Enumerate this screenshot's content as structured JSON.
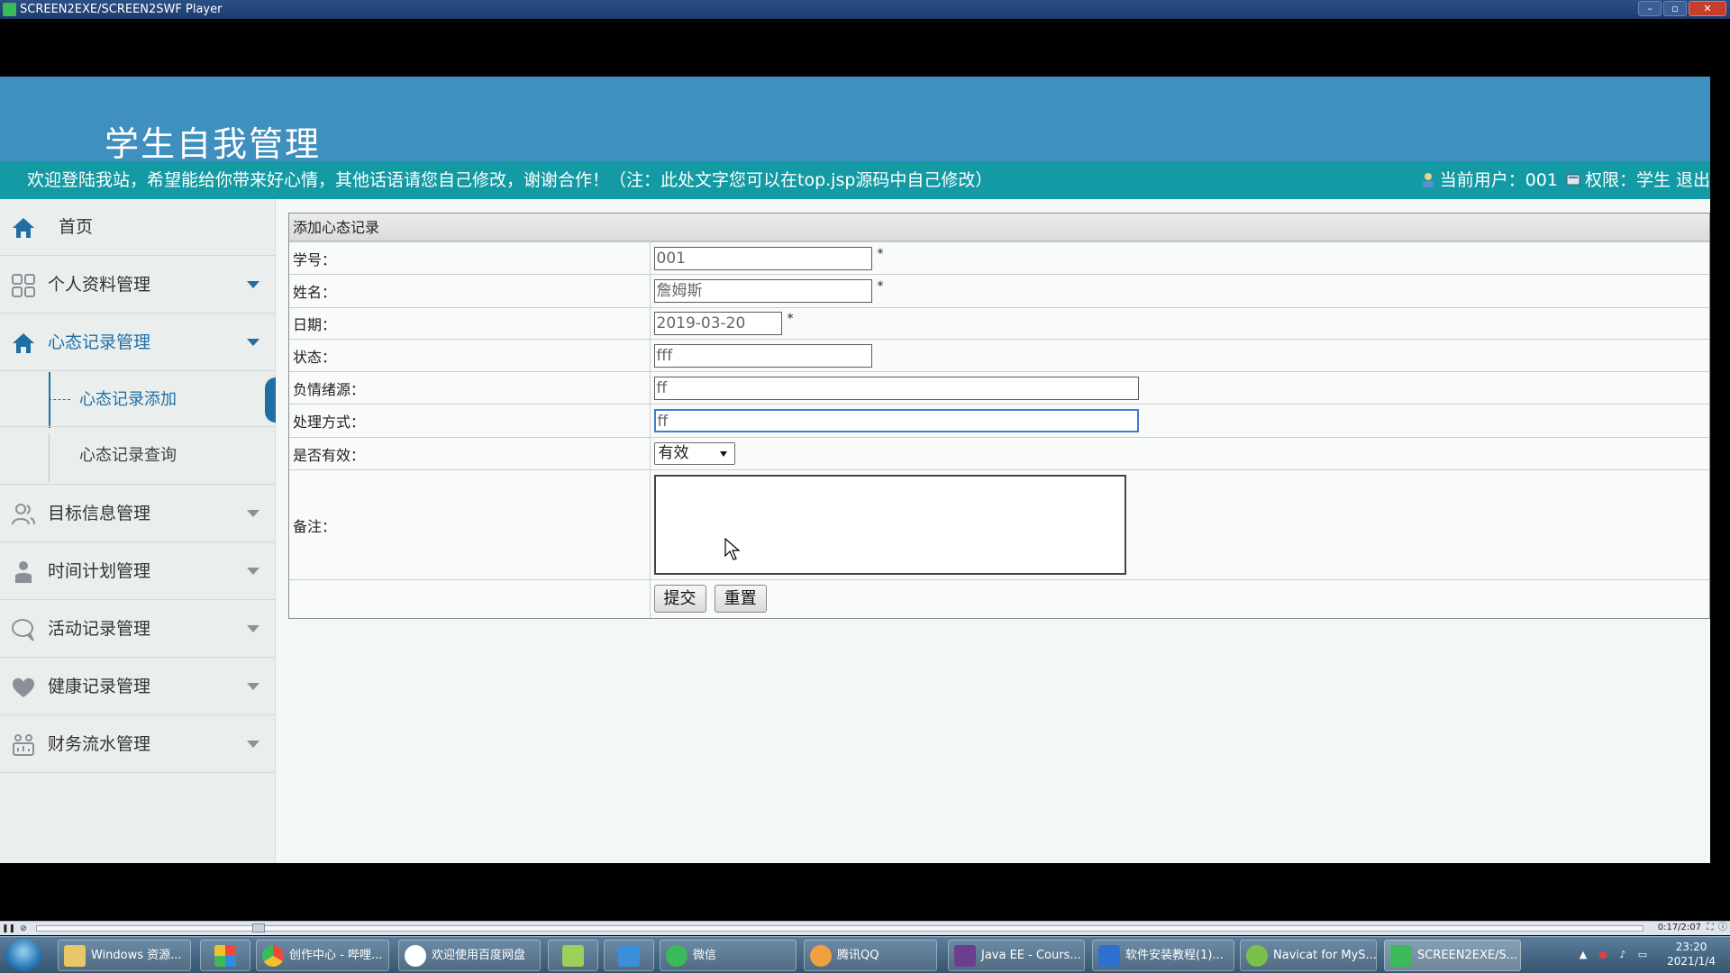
{
  "player": {
    "title": "SCREEN2EXE/SCREEN2SWF Player",
    "time": "0:17/2:07"
  },
  "site": {
    "title": "学生自我管理",
    "welcome": "欢迎登陆我站，希望能给你带来好心情，其他话语请您自己修改，谢谢合作！（注：此处文字您可以在top.jsp源码中自己修改）",
    "current_user_label": "当前用户：001",
    "role_label": "权限：学生",
    "logout": "退出"
  },
  "sidebar": {
    "home": "首页",
    "items": [
      {
        "label": "个人资料管理",
        "icon": "grid-icon"
      },
      {
        "label": "心态记录管理",
        "icon": "home-icon"
      },
      {
        "label": "目标信息管理",
        "icon": "users-icon"
      },
      {
        "label": "时间计划管理",
        "icon": "person-icon"
      },
      {
        "label": "活动记录管理",
        "icon": "chat-icon"
      },
      {
        "label": "健康记录管理",
        "icon": "heart-icon"
      },
      {
        "label": "财务流水管理",
        "icon": "chart-icon"
      }
    ],
    "sub_items": [
      "心态记录添加",
      "心态记录查询"
    ]
  },
  "form": {
    "title": "添加心态记录",
    "student_id": {
      "label": "学号：",
      "value": "001"
    },
    "name": {
      "label": "姓名：",
      "value": "詹姆斯"
    },
    "date": {
      "label": "日期：",
      "value": "2019-03-20"
    },
    "status": {
      "label": "状态：",
      "value": "fff"
    },
    "source": {
      "label": "负情绪源：",
      "value": "ff"
    },
    "handling": {
      "label": "处理方式：",
      "value": "ff"
    },
    "valid": {
      "label": "是否有效：",
      "value": "有效"
    },
    "remark": {
      "label": "备注：",
      "value": ""
    },
    "required_mark": "*",
    "submit": "提交",
    "reset": "重置"
  },
  "taskbar": {
    "items": [
      {
        "label": "Windows 资源..."
      },
      {
        "label": ""
      },
      {
        "label": "创作中心 - 哔哩..."
      },
      {
        "label": "欢迎使用百度网盘"
      },
      {
        "label": ""
      },
      {
        "label": ""
      },
      {
        "label": "微信"
      },
      {
        "label": "腾讯QQ"
      },
      {
        "label": "Java EE - Cours..."
      },
      {
        "label": "软件安装教程(1)..."
      },
      {
        "label": "Navicat for MyS..."
      },
      {
        "label": "SCREEN2EXE/S..."
      }
    ],
    "clock_time": "23:20",
    "clock_date": "2021/1/4"
  }
}
